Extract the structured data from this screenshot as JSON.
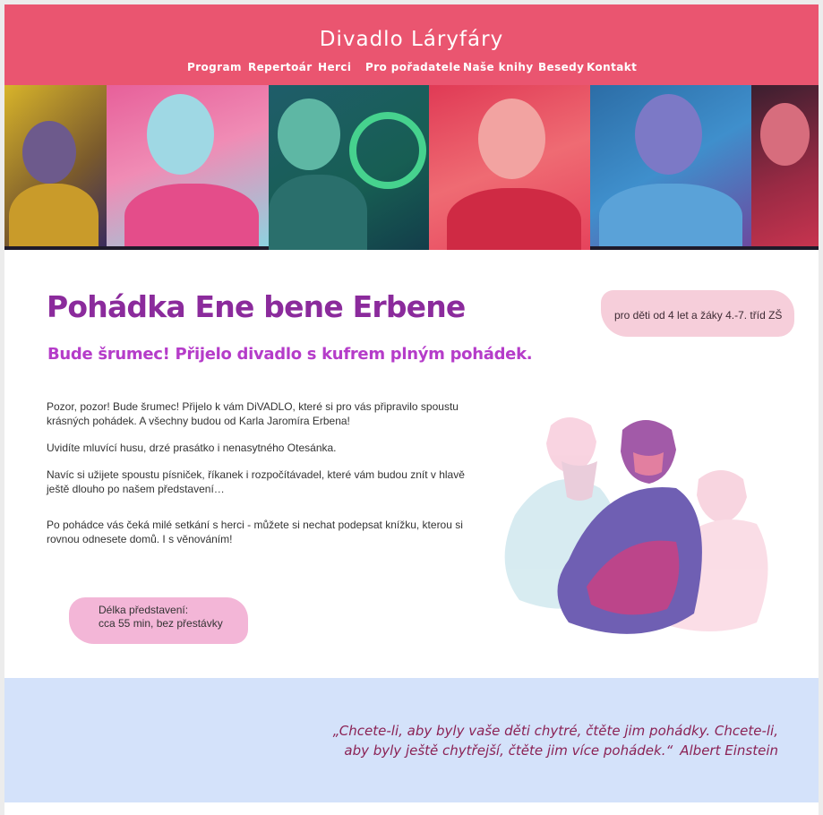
{
  "site": {
    "title": "Divadlo Láryfáry"
  },
  "nav": {
    "items": [
      {
        "label": "Program"
      },
      {
        "label": "Repertoár"
      },
      {
        "label": "Herci"
      },
      {
        "label": "Pro pořadatele"
      },
      {
        "label": "Naše knihy"
      },
      {
        "label": "Besedy"
      },
      {
        "label": "Kontakt"
      }
    ]
  },
  "show": {
    "title": "Pohádka Ene bene Erbene",
    "subtitle": "Bude šrumec! Přijelo divadlo s kufrem plným pohádek.",
    "age": "pro děti od 4 let a žáky 4.-7. tříd ZŠ",
    "paragraphs": [
      "Pozor, pozor! Bude šrumec! Přijelo k vám DiVADLO, které si pro vás připravilo spoustu krásných pohádek. A všechny budou od Karla Jaromíra Erbena!",
      "Uvidíte mluvící husu, drzé prasátko i nenasytného Otesánka.",
      "Navíc si užijete spoustu písniček, říkanek i rozpočítávadel, které vám budou znít v hlavě ještě dlouho po našem představení…",
      "Po pohádce vás čeká milé setkání s herci - můžete si nechat podepsat knížku, kterou si rovnou odnesete domů. I s věnováním!"
    ],
    "duration_label": "Délka představení:",
    "duration_value": "cca 55 min, bez přestávky"
  },
  "quote": {
    "text": "„Chcete-li, aby byly vaše děti chytré, čtěte jim pohádky. Chcete-li, aby byly ještě chytřejší, čtěte jim více pohádek.“",
    "author": "Albert Einstein"
  },
  "colors": {
    "header": "#ea5570",
    "title": "#8b2b9c",
    "subtitle": "#b53cc9",
    "quote_band": "#d4e2fa",
    "quote_text": "#8b2255"
  }
}
